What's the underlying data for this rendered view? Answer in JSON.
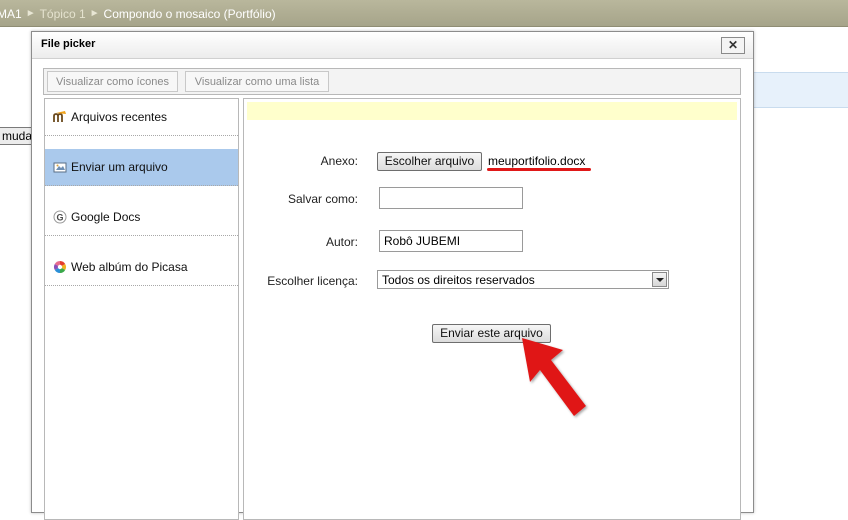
{
  "breadcrumb": {
    "items": [
      "MA1",
      "Tópico 1",
      "Compondo o mosaico (Portfólio)"
    ],
    "separator": "►"
  },
  "background_page": {
    "button_fragment": "muda"
  },
  "dialog": {
    "title": "File picker",
    "close_glyph": "✕",
    "toolbar": {
      "icons_view_label": "Visualizar como ícones",
      "list_view_label": "Visualizar como uma lista"
    },
    "sidebar": {
      "items": [
        {
          "label": "Arquivos recentes",
          "icon": "moodle-icon",
          "active": false
        },
        {
          "label": "Enviar um arquivo",
          "icon": "upload-icon",
          "active": true
        },
        {
          "label": "Google Docs",
          "icon": "google-icon",
          "active": false
        },
        {
          "label": "Web albúm do Picasa",
          "icon": "picasa-icon",
          "active": false
        }
      ]
    },
    "form": {
      "attachment_label": "Anexo:",
      "choose_file_button": "Escolher arquivo",
      "chosen_file": "meuportifolio.docx",
      "save_as_label": "Salvar como:",
      "save_as_value": "",
      "author_label": "Autor:",
      "author_value": "Robô JUBEMI",
      "license_label": "Escolher licença:",
      "license_value": "Todos os direitos reservados",
      "submit_button": "Enviar este arquivo"
    }
  },
  "colors": {
    "breadcrumb_bar": "#aeac92",
    "active_item": "#aac9ec",
    "notice_bg": "#ffffcc",
    "annotation_red": "#e01818"
  }
}
